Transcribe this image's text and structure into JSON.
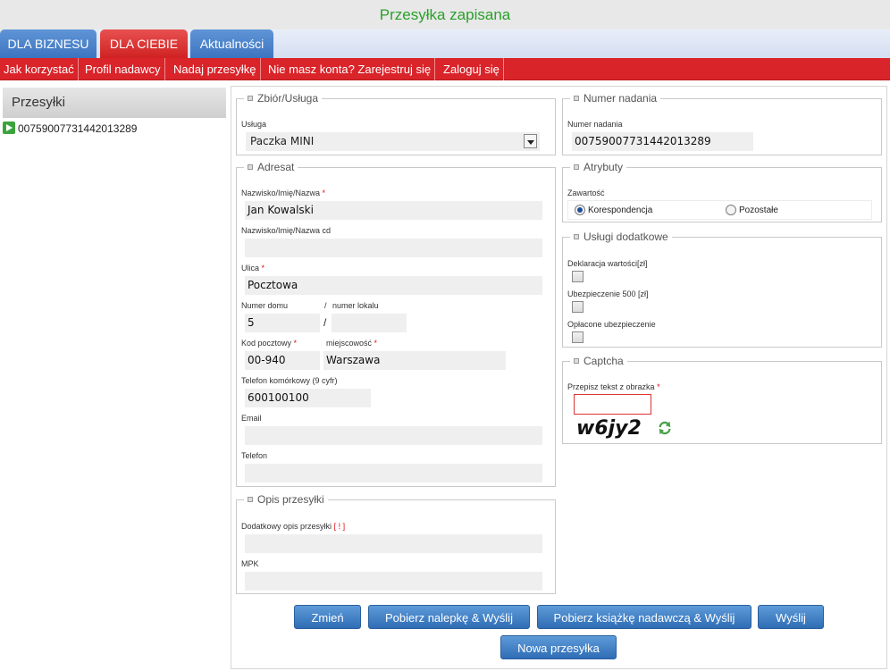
{
  "status_message": "Przesyłka zapisana",
  "tabs": [
    {
      "label": "DLA BIZNESU"
    },
    {
      "label": "DLA CIEBIE"
    },
    {
      "label": "Aktualności"
    }
  ],
  "menu": [
    {
      "label": "Jak korzystać"
    },
    {
      "label": "Profil nadawcy"
    },
    {
      "label": "Nadaj przesyłkę"
    },
    {
      "label": "Nie masz konta? Zarejestruj się"
    },
    {
      "label": "Zaloguj się"
    }
  ],
  "sidebar": {
    "title": "Przesyłki",
    "items": [
      {
        "label": "00759007731442013289"
      }
    ]
  },
  "service": {
    "legend": "Zbiór/Usługa",
    "label": "Usługa",
    "value": "Paczka MINI"
  },
  "tracking": {
    "legend": "Numer nadania",
    "label": "Numer nadania",
    "value": "00759007731442013289"
  },
  "address": {
    "legend": "Adresat",
    "name_label": "Nazwisko/Imię/Nazwa",
    "name_value": "Jan Kowalski",
    "name2_label": "Nazwisko/Imię/Nazwa cd",
    "name2_value": "",
    "street_label": "Ulica",
    "street_value": "Pocztowa",
    "house_label": "Numer domu",
    "house_value": "5",
    "sep": "/",
    "flat_label": "numer lokalu",
    "flat_value": "",
    "postal_label": "Kod pocztowy",
    "postal_value": "00-940",
    "city_label": "miejscowość",
    "city_value": "Warszawa",
    "mobile_label": "Telefon komórkowy (9 cyfr)",
    "mobile_value": "600100100",
    "email_label": "Email",
    "email_value": "",
    "phone_label": "Telefon",
    "phone_value": ""
  },
  "required_mark": "*",
  "attributes": {
    "legend": "Atrybuty",
    "label": "Zawartość",
    "options": [
      {
        "label": "Korespondencja",
        "checked": true
      },
      {
        "label": "Pozostałe",
        "checked": false
      }
    ]
  },
  "extra_services": {
    "legend": "Usługi dodatkowe",
    "items": [
      {
        "label": "Deklaracja wartości[zł]",
        "checked": false
      },
      {
        "label": "Ubezpieczenie 500 [zł]",
        "checked": false
      },
      {
        "label": "Opłacone ubezpieczenie",
        "checked": false
      }
    ]
  },
  "captcha": {
    "legend": "Captcha",
    "label": "Przepisz tekst z obrazka",
    "value": "",
    "image_text": "w6jy2"
  },
  "description": {
    "legend": "Opis przesyłki",
    "desc_label": "Dodatkowy opis przesyłki",
    "desc_hint": "[ ! ]",
    "desc_value": "",
    "mpk_label": "MPK",
    "mpk_value": ""
  },
  "buttons": {
    "change": "Zmień",
    "label_send": "Pobierz nalepkę & Wyślij",
    "book_send": "Pobierz książkę nadawczą & Wyślij",
    "send": "Wyślij",
    "new": "Nowa przesyłka"
  },
  "colors": {
    "status_green": "#2aa02a",
    "tab_blue": "#4a82cc",
    "tab_red": "#d9242a",
    "button_blue": "#3f7cc4"
  }
}
